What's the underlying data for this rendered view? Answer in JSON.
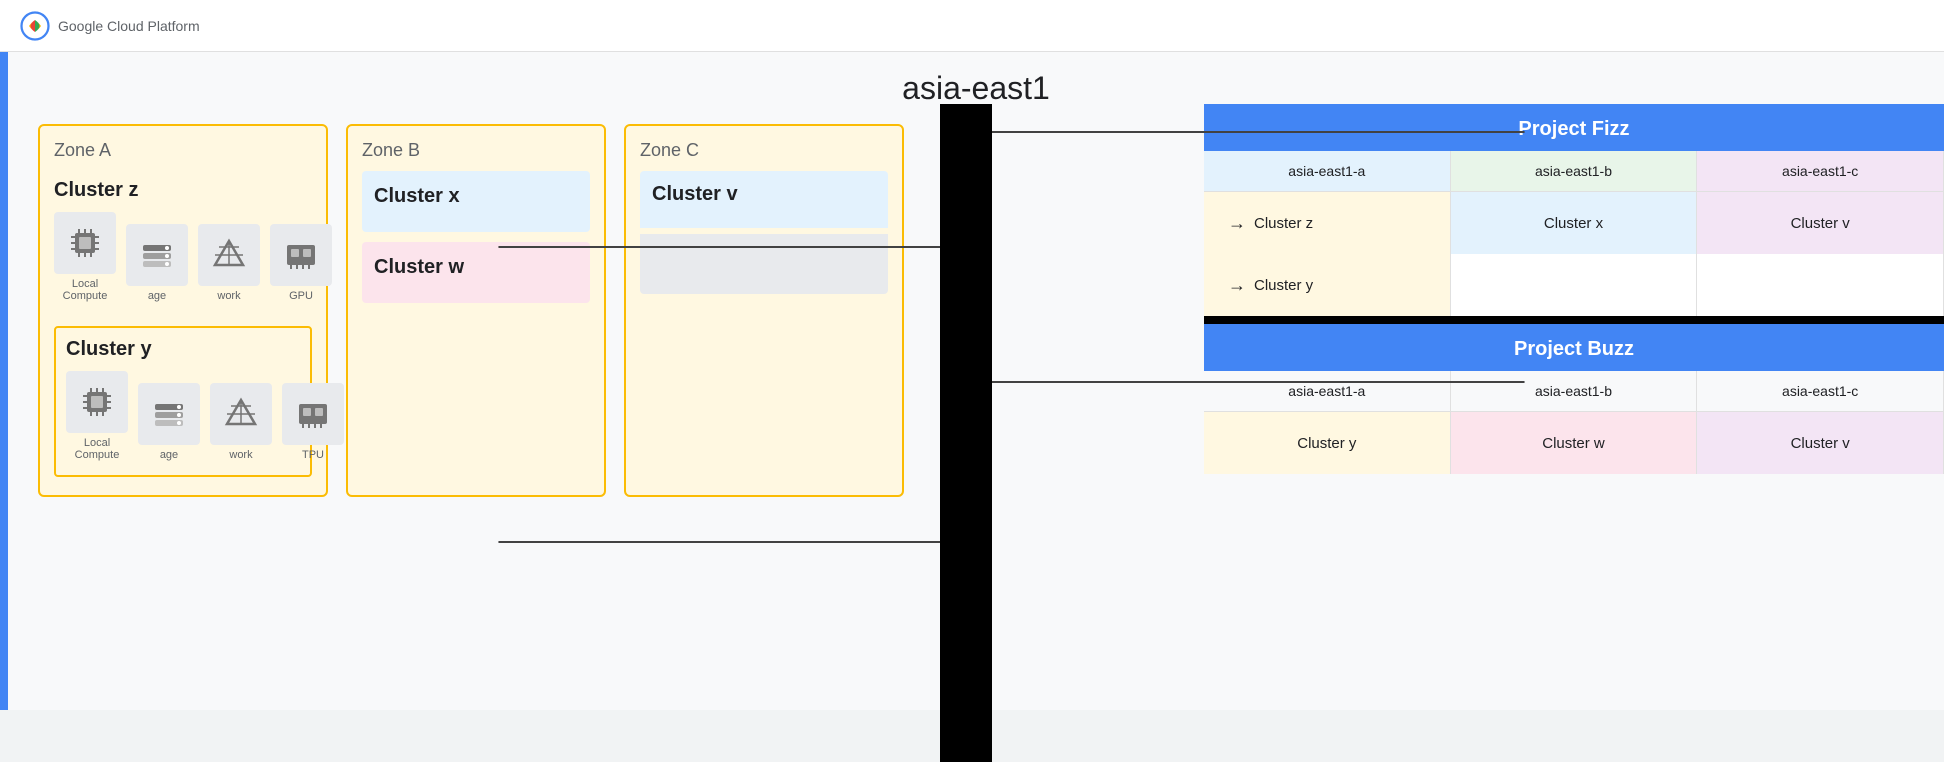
{
  "header": {
    "logo_text": "Google Cloud Platform"
  },
  "region": {
    "label": "asia-east1"
  },
  "zones": {
    "zone_a": {
      "label": "Zone A",
      "cluster_z": {
        "heading": "Cluster z",
        "icons": [
          {
            "label": "Local\nCompute",
            "icon": "🖥"
          },
          {
            "label": "age",
            "icon": "▦"
          },
          {
            "label": "work",
            "icon": "▶"
          },
          {
            "label": "GPU",
            "icon": "▦"
          }
        ]
      },
      "cluster_y": {
        "heading": "Cluster y",
        "icons": [
          {
            "label": "Local\nCompute",
            "icon": "🖥"
          },
          {
            "label": "age",
            "icon": "▦"
          },
          {
            "label": "work",
            "icon": "▶"
          },
          {
            "label": "TPU",
            "icon": "▦"
          }
        ]
      }
    },
    "zone_b": {
      "label": "Zone B",
      "cluster_x": {
        "heading": "Cluster x"
      },
      "cluster_w": {
        "heading": "Cluster w"
      }
    },
    "zone_c": {
      "label": "Zone C",
      "cluster_v": {
        "heading": "Cluster v"
      }
    }
  },
  "project_fizz": {
    "title": "Project Fizz",
    "regions": [
      "asia-east1-a",
      "asia-east1-b",
      "asia-east1-c"
    ],
    "clusters": {
      "col_a": {
        "cluster_z": "Cluster z",
        "cluster_y": "Cluster y"
      },
      "col_b": {
        "cluster_x": "Cluster x"
      },
      "col_c": {
        "cluster_v": "Cluster v"
      }
    }
  },
  "project_buzz": {
    "title": "Project Buzz",
    "regions": [
      "asia-east1-a",
      "asia-east1-b",
      "asia-east1-c"
    ],
    "clusters": {
      "col_a": "Cluster y",
      "col_b": "Cluster w",
      "col_c": "Cluster v"
    }
  }
}
